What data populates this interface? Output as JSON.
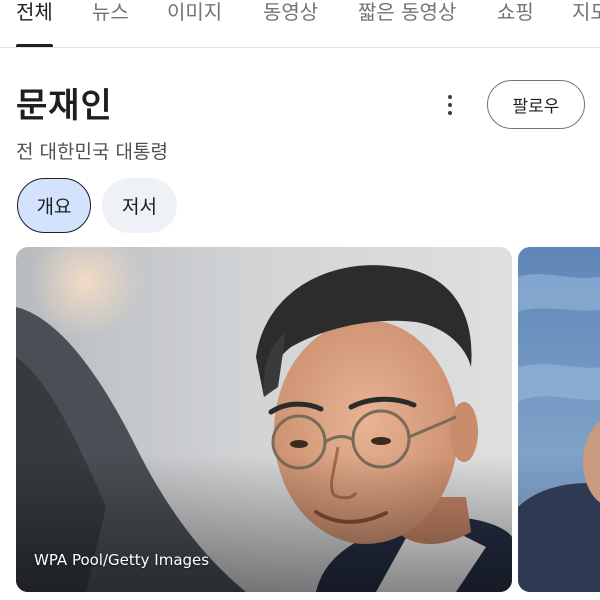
{
  "tabs": [
    {
      "label": "전체",
      "active": true
    },
    {
      "label": "뉴스",
      "active": false
    },
    {
      "label": "이미지",
      "active": false
    },
    {
      "label": "동영상",
      "active": false
    },
    {
      "label": "짧은 동영상",
      "active": false
    },
    {
      "label": "쇼핑",
      "active": false
    },
    {
      "label": "지도",
      "active": false
    }
  ],
  "entity": {
    "name": "문재인",
    "description": "전 대한민국 대통령",
    "follow_label": "팔로우"
  },
  "chips": [
    {
      "label": "개요",
      "selected": true
    },
    {
      "label": "저서",
      "selected": false
    }
  ],
  "image": {
    "credit": "WPA Pool/Getty Images"
  },
  "colors": {
    "selected_chip_bg": "#d3e3fd",
    "chip_bg": "#eef1f5",
    "text_primary": "#1f1f1f",
    "text_secondary": "#4d5156",
    "tab_inactive": "#70757a"
  },
  "icons": {
    "more": "vertical-dots-icon"
  }
}
